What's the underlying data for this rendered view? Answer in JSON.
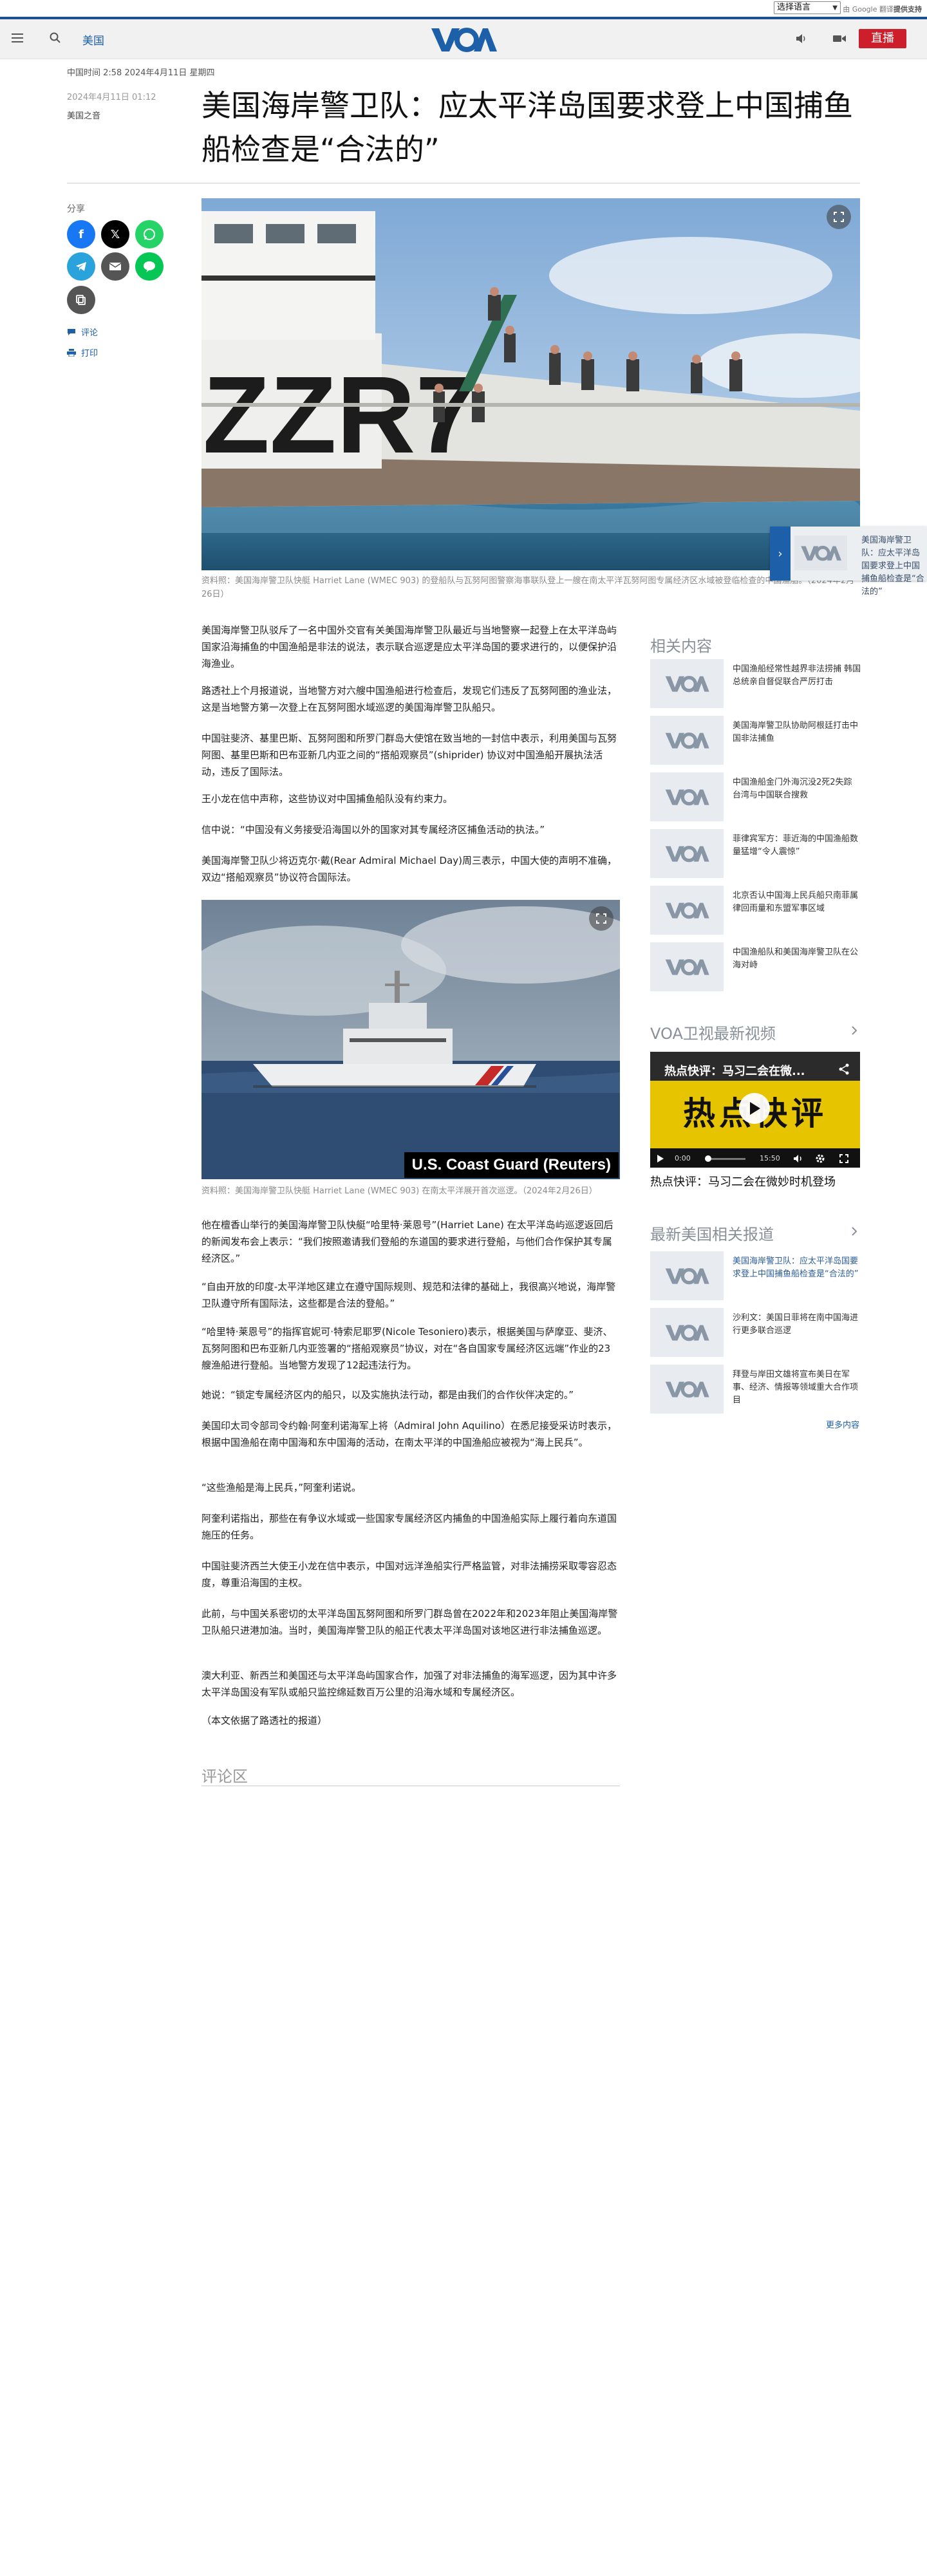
{
  "translate": {
    "select_label": "选择语言",
    "powered_by": "由 Google 翻译",
    "powered_suffix": "提供支持"
  },
  "header": {
    "section": "美国",
    "live_label": "直播"
  },
  "article": {
    "datetime_line": "中国时间 2:58 2024年4月11日 星期四",
    "date": "2024年4月11日 01:12",
    "author": "美国之音",
    "title": "美国海岸警卫队：应太平洋岛国要求登上中国捕鱼船检查是“合法的”",
    "share_label": "分享",
    "comment_link": "评论",
    "print_link": "打印",
    "hero_caption": "资料照：美国海岸警卫队快艇 Harriet Lane (WMEC 903) 的登船队与瓦努阿图警察海事联队登上一艘在南太平洋瓦努阿图专属经济区水域被登临检查的中国渔船。（2024年2月26日）",
    "paragraphs_a": [
      "美国海岸警卫队驳斥了一名中国外交官有关美国海岸警卫队最近与当地警察一起登上在太平洋岛屿国家沿海捕鱼的中国渔船是非法的说法，表示联合巡逻是应太平洋岛国的要求进行的，以便保护沿海渔业。",
      "路透社上个月报道说，当地警方对六艘中国渔船进行检查后，发现它们违反了瓦努阿图的渔业法，这是当地警方第一次登上在瓦努阿图水域巡逻的美国海岸警卫队船只。",
      "中国驻斐济、基里巴斯、瓦努阿图和所罗门群岛大使馆在致当地的一封信中表示，利用美国与瓦努阿图、基里巴斯和巴布亚新几内亚之间的“搭船观察员”(shiprider) 协议对中国渔船开展执法活动，违反了国际法。",
      "王小龙在信中声称，这些协议对中国捕鱼船队没有约束力。",
      "信中说：“中国没有义务接受沿海国以外的国家对其专属经济区捕鱼活动的执法。”",
      "美国海岸警卫队少将迈克尔·戴(Rear Admiral Michael Day)周三表示，中国大使的声明不准确，双边“搭船观察员”协议符合国际法。"
    ],
    "image2_badge": "U.S. Coast Guard (Reuters)",
    "image2_caption": "资料照：美国海岸警卫队快艇 Harriet Lane (WMEC 903) 在南太平洋展开首次巡逻。（2024年2月26日）",
    "paragraphs_b": [
      "他在檀香山举行的美国海岸警卫队快艇“哈里特·莱恩号”(Harriet Lane) 在太平洋岛屿巡逻返回后的新闻发布会上表示：“我们按照邀请我们登船的东道国的要求进行登船，与他们合作保护其专属经济区。”",
      "“自由开放的印度-太平洋地区建立在遵守国际规则、规范和法律的基础上，我很高兴地说，海岸警卫队遵守所有国际法，这些都是合法的登船。”",
      "“哈里特·莱恩号”的指挥官妮可·特索尼耶罗(Nicole Tesoniero)表示，根据美国与萨摩亚、斐济、瓦努阿图和巴布亚新几内亚签署的“搭船观察员”协议，对在“各自国家专属经济区远端”作业的23艘渔船进行登船。当地警方发现了12起违法行为。",
      "她说：“锁定专属经济区内的船只，以及实施执法行动，都是由我们的合作伙伴决定的。”",
      "美国印太司令部司令约翰·阿奎利诺海军上将（Admiral John Aquilino）在悉尼接受采访时表示，根据中国渔船在南中国海和东中国海的活动，在南太平洋的中国渔船应被视为“海上民兵”。",
      "“这些渔船是海上民兵，”阿奎利诺说。",
      "阿奎利诺指出，那些在有争议水域或一些国家专属经济区内捕鱼的中国渔船实际上履行着向东道国施压的任务。",
      "中国驻斐济西兰大使王小龙在信中表示，中国对远洋渔船实行严格监管，对非法捕捞采取零容忍态度，尊重沿海国的主权。",
      "此前，与中国关系密切的太平洋岛国瓦努阿图和所罗门群岛曾在2022年和2023年阻止美国海岸警卫队船只进港加油。当时，美国海岸警卫队的船正代表太平洋岛国对该地区进行非法捕鱼巡逻。",
      "澳大利亚、新西兰和美国还与太平洋岛屿国家合作，加强了对非法捕鱼的海军巡逻，因为其中许多太平洋岛国没有军队或船只监控绵延数百万公里的沿海水域和专属经济区。",
      "（本文依据了路透社的报道）"
    ],
    "comments_title": "评论区"
  },
  "float_widget": {
    "text": "美国海岸警卫队：应太平洋岛国要求登上中国捕鱼船检查是“合法的”"
  },
  "sidebar": {
    "related_title": "相关内容",
    "related": [
      "中国渔船经常性越界非法捞捕 韩国总统亲自督促联合严厉打击",
      "美国海岸警卫队协助阿根廷打击中国非法捕鱼",
      "中国渔船金门外海沉没2死2失踪 台湾与中国联合搜救",
      "菲律宾军方：菲近海的中国渔船数量猛增“令人震惊”",
      "北京否认中国海上民兵船只南菲属律回雨量和东盟军事区域",
      "中国渔船队和美国海岸警卫队在公海对峙"
    ],
    "video_title": "VOA卫视最新视频",
    "video": {
      "overlay_title": "热点快评：马习二会在微...",
      "big_text": "热点快评",
      "time_current": "0:00",
      "time_total": "15:50",
      "caption": "热点快评：马习二会在微妙时机登场"
    },
    "latest_title": "最新美国相关报道",
    "latest": [
      "美国海岸警卫队：应太平洋岛国要求登上中国捕鱼船检查是“合法的”",
      "沙利文：美国日菲将在南中国海进行更多联合巡逻",
      "拜登与岸田文雄将宣布美日在军事、经济、情报等领域重大合作项目"
    ],
    "more_label": "更多内容"
  },
  "colors": {
    "brand_blue": "#1d4f91",
    "live_red": "#cc1f2b",
    "link_blue": "#1d5fa8"
  }
}
